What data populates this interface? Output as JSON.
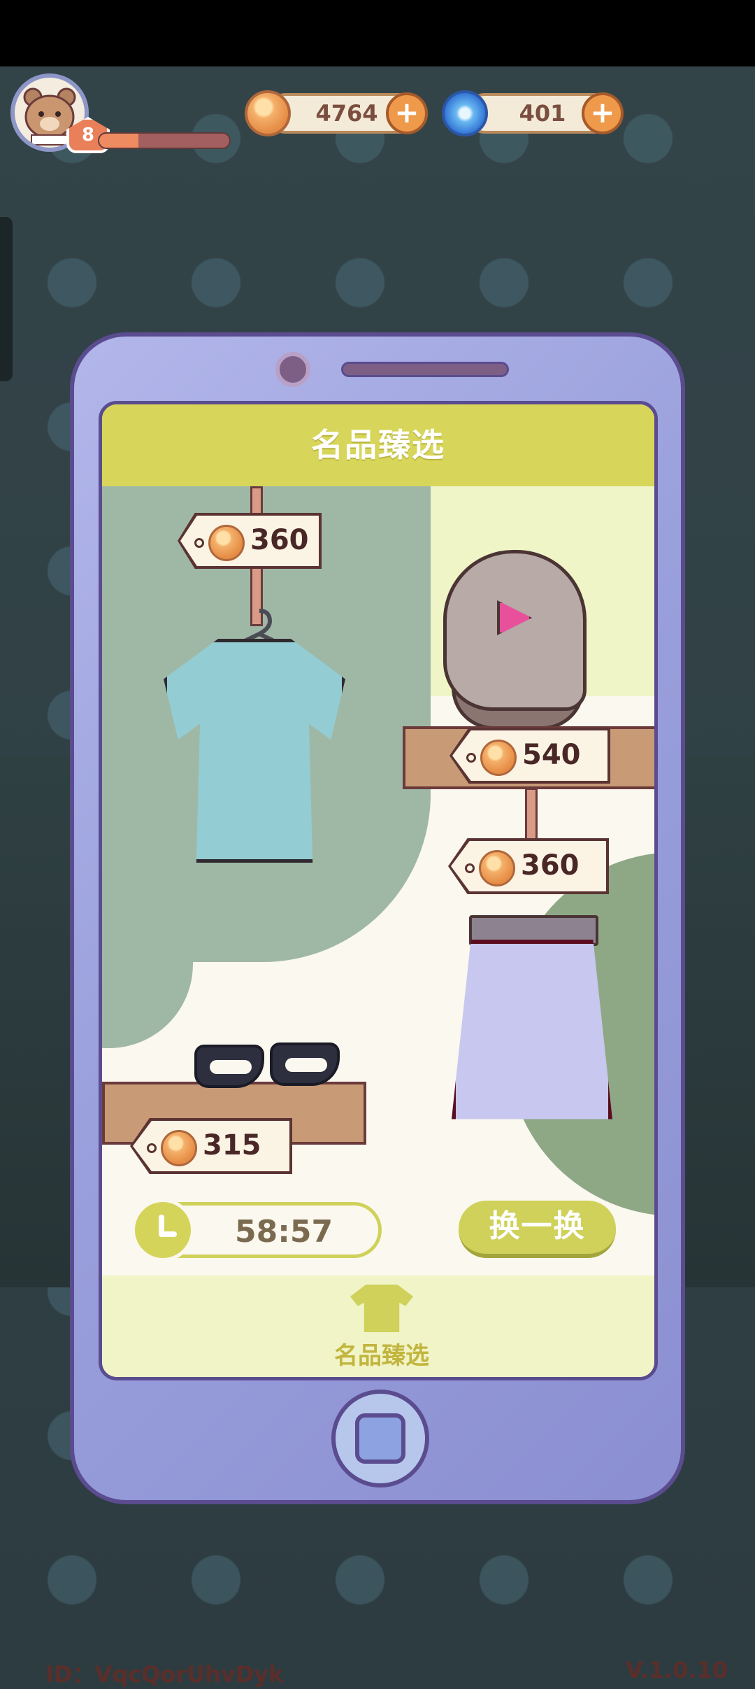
{
  "player": {
    "level": "8",
    "xp_progress": 0.3
  },
  "currencies": {
    "coins": "4764",
    "gems": "401"
  },
  "shop": {
    "title": "名品臻选",
    "items": [
      {
        "name": "blue t-shirt",
        "price": "360"
      },
      {
        "name": "hair with pink clip",
        "price": "540"
      },
      {
        "name": "lavender skirt",
        "price": "360"
      },
      {
        "name": "black shoes",
        "price": "315"
      }
    ],
    "timer": "58:57",
    "refresh_label": "换一换",
    "tab_label": "名品臻选"
  },
  "footer": {
    "id_text": "ID：VqcQorUhvDyk",
    "version": "V.1.0.10"
  },
  "colors": {
    "accent": "#d7d65a",
    "phone_body": "#9aa0dc",
    "coin": "#f4b06a",
    "gem": "#2f6fd3"
  }
}
